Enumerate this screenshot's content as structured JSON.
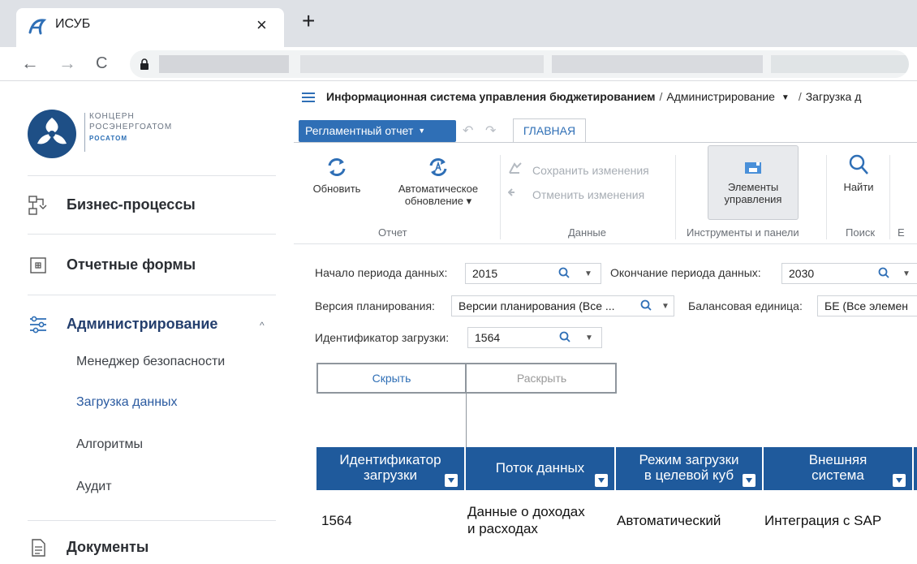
{
  "browser": {
    "tab_title": "ИСУБ",
    "close_glyph": "×",
    "new_tab_glyph": "+",
    "back_glyph": "←",
    "forward_glyph": "→",
    "reload_glyph": "C"
  },
  "sidebar": {
    "brand": {
      "line1": "КОНЦЕРН",
      "line2": "РОСЭНЕРГОАТОМ",
      "line3": "РОСАТОМ"
    },
    "items": [
      {
        "label": "Бизнес-процессы",
        "icon": "flowchart-icon"
      },
      {
        "label": "Отчетные формы",
        "icon": "grid-icon"
      },
      {
        "label": "Администрирование",
        "icon": "sliders-icon",
        "expanded": true
      },
      {
        "label": "Документы",
        "icon": "document-icon"
      }
    ],
    "chevron_glyph": "^",
    "subitems": [
      "Менеджер безопасности",
      "Загрузка данных",
      "Алгоритмы",
      "Аудит"
    ],
    "active_subitem": "Загрузка данных"
  },
  "breadcrumb": {
    "root": "Информационная система управления бюджетированием",
    "sep": "/",
    "section": "Администрирование",
    "current": "Загрузка д",
    "dropdown_glyph": "▼"
  },
  "toolbar": {
    "report_button": "Регламентный отчет",
    "report_caret": "▼",
    "undo_glyph": "↶",
    "redo_glyph": "↷",
    "tab_main": "ГЛАВНАЯ"
  },
  "ribbon": {
    "refresh": "Обновить",
    "auto_refresh_line1": "Автоматическое",
    "auto_refresh_line2": "обновление ▾",
    "save": "Сохранить изменения",
    "cancel": "Отменить изменения",
    "controls_line1": "Элементы",
    "controls_line2": "управления",
    "find": "Найти",
    "groups": [
      "Отчет",
      "Данные",
      "Инструменты и панели",
      "Поиск",
      "E"
    ]
  },
  "filters": {
    "start_label": "Начало периода данных:",
    "start_value": "2015",
    "end_label": "Окончание периода данных:",
    "end_value": "2030",
    "version_label": "Версия планирования:",
    "version_value": "Версии планирования (Все ...",
    "balance_label": "Балансовая единица:",
    "balance_value": "БЕ (Все элемен",
    "load_id_label": "Идентификатор загрузки:",
    "load_id_value": "1564",
    "caret": "▼"
  },
  "toggle": {
    "hide": "Скрыть",
    "expand": "Раскрыть"
  },
  "table": {
    "columns": [
      {
        "line1": "Идентификатор",
        "line2": "загрузки"
      },
      {
        "line1": "Поток данных",
        "line2": ""
      },
      {
        "line1": "Режим загрузки",
        "line2": "в целевой куб"
      },
      {
        "line1": "Внешняя",
        "line2": "система"
      }
    ],
    "rows": [
      {
        "id": "1564",
        "flow_line1": "Данные о доходах",
        "flow_line2": "и расходах",
        "mode": "Автоматический",
        "system": "Интеграция с SAP"
      }
    ]
  },
  "colors": {
    "accent": "#2f6fb6",
    "header_bg": "#1f5a9c",
    "brand": "#1e4f86"
  }
}
